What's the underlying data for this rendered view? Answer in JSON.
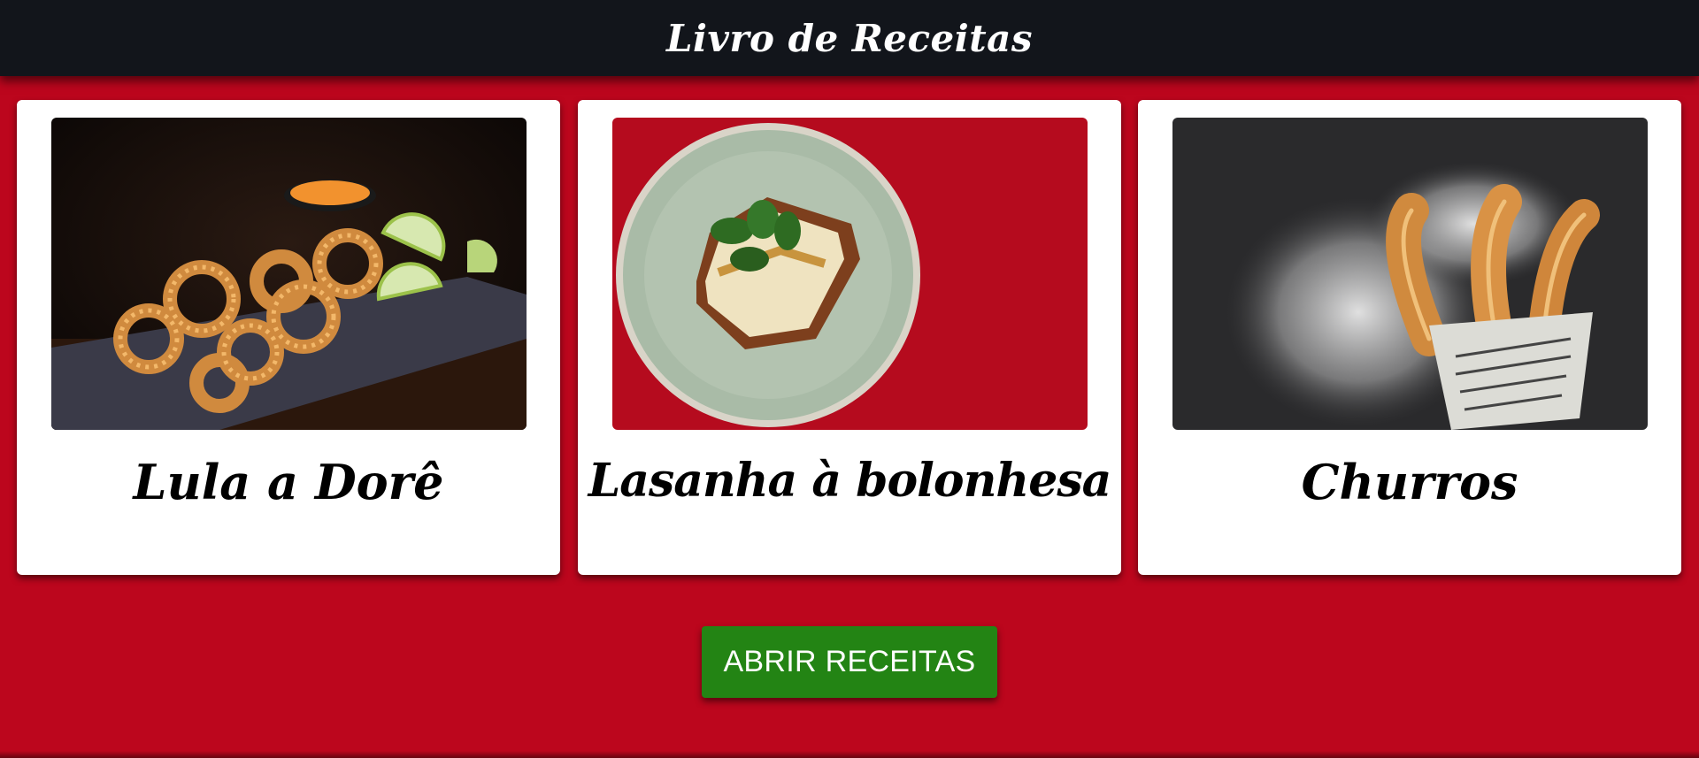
{
  "header": {
    "title": "Livro de Receitas"
  },
  "recipes": [
    {
      "title": "Lula a Dorê",
      "image": "fried-calamari-photo"
    },
    {
      "title": "Lasanha à bolonhesa",
      "image": "lasagna-photo"
    },
    {
      "title": "Churros",
      "image": "churros-photo"
    }
  ],
  "actions": {
    "open_label": "ABRIR RECEITAS"
  },
  "colors": {
    "background": "#bc061d",
    "header": "#12151b",
    "button": "#238414",
    "card": "#ffffff"
  }
}
